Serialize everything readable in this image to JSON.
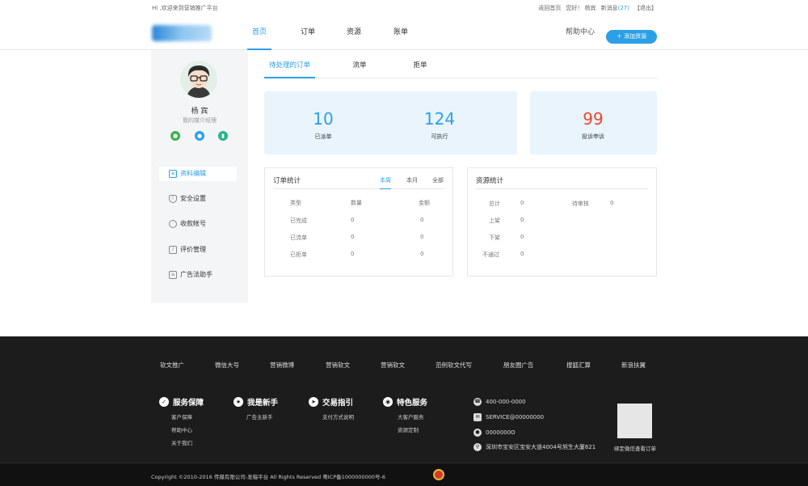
{
  "topbar": {
    "welcome": "Hi ,欢迎来到营销推广平台",
    "links": [
      "返回首页",
      "您好！ 杨宾",
      "新消息"
    ],
    "msg_count": "(27)",
    "logout": "【退出】"
  },
  "nav": {
    "items": [
      "首页",
      "订单",
      "资源",
      "账单"
    ],
    "help": "帮助中心",
    "add_button": "添加资源"
  },
  "profile": {
    "name": "杨 宾",
    "role": "我的媒介经理"
  },
  "sidebar": {
    "items": [
      "资料编辑",
      "安全设置",
      "收款帐号",
      "评价管理",
      "广告法助手"
    ]
  },
  "tabs": [
    "待处理的订单",
    "流单",
    "拒单"
  ],
  "stats": {
    "dispatched": {
      "value": "10",
      "label": "已派单"
    },
    "executable": {
      "value": "124",
      "label": "可执行"
    },
    "complaints": {
      "value": "99",
      "label": "投诉申诉"
    }
  },
  "order_stats": {
    "title": "订单统计",
    "periods": [
      "本周",
      "本月",
      "全部"
    ],
    "headers": [
      "类型",
      "数量",
      "金额"
    ],
    "rows": [
      [
        "已完成",
        "0",
        "0"
      ],
      [
        "已流单",
        "0",
        "0"
      ],
      [
        "已拒单",
        "0",
        "0"
      ]
    ]
  },
  "resource_stats": {
    "title": "资源统计",
    "left": [
      [
        "总计",
        "0"
      ],
      [
        "上架",
        "0"
      ],
      [
        "下架",
        "0"
      ],
      [
        "不通过",
        "0"
      ]
    ],
    "right": [
      [
        "待审核",
        "0"
      ]
    ]
  },
  "footer": {
    "links": [
      "软文推广",
      "微信大号",
      "营销微博",
      "营销软文",
      "营销软文",
      "范例软文代写",
      "朋友圈广告",
      "搜狐汇算",
      "新浪扶翼"
    ],
    "sections": [
      {
        "title": "服务保障",
        "items": [
          "客户保障",
          "帮助中心",
          "关于我们"
        ]
      },
      {
        "title": "我是新手",
        "items": [
          "广告主新手"
        ]
      },
      {
        "title": "交易指引",
        "items": [
          "支付方式说明"
        ]
      },
      {
        "title": "特色服务",
        "items": [
          "大客户服务",
          "资源定制"
        ]
      }
    ],
    "contact": [
      "400-000-0000",
      "SERVICE@00000000",
      "0000000O",
      "深圳市宝安区宝安大道4004号旭生大厦621"
    ],
    "qr_label": "绑定微信查看订单",
    "copyright": "Copyright ©2010-2016 传媒有限公司-发稿平台 All Rights Reserved 粤ICP备1000000000号-6"
  },
  "colors": {
    "accent": "#2ba0e6",
    "complaint": "#e8482a",
    "footer_bg": "#1c1c1c"
  }
}
